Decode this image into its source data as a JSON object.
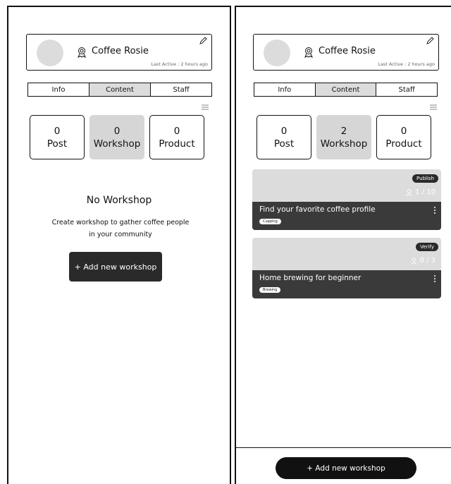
{
  "profile": {
    "name": "Coffee Rosie",
    "last_active": "Last Active : 2 hours ago"
  },
  "tabs": [
    "Info",
    "Content",
    "Staff"
  ],
  "left_screen": {
    "stats": [
      {
        "count": "0",
        "label": "Post"
      },
      {
        "count": "0",
        "label": "Workshop"
      },
      {
        "count": "0",
        "label": "Product"
      }
    ],
    "empty_title": "No Workshop",
    "empty_desc_line1": "Create workshop to gather coffee people",
    "empty_desc_line2": "in your community",
    "add_button": "+ Add new workshop"
  },
  "right_screen": {
    "stats": [
      {
        "count": "0",
        "label": "Post"
      },
      {
        "count": "2",
        "label": "Workshop"
      },
      {
        "count": "0",
        "label": "Product"
      }
    ],
    "workshops": [
      {
        "title": "Find your favorite coffee profile",
        "tag": "Cupping",
        "status": "Publish",
        "participants": "1 / 10"
      },
      {
        "title": "Home brewing for beginner",
        "tag": "Brewing",
        "status": "Verify",
        "participants": "0 / 3"
      }
    ],
    "add_button": "+ Add new workshop"
  },
  "colors": {
    "dark": "#2a2a2a",
    "card_gray": "#dcdcdc",
    "active_tab": "#dcdcdc"
  }
}
